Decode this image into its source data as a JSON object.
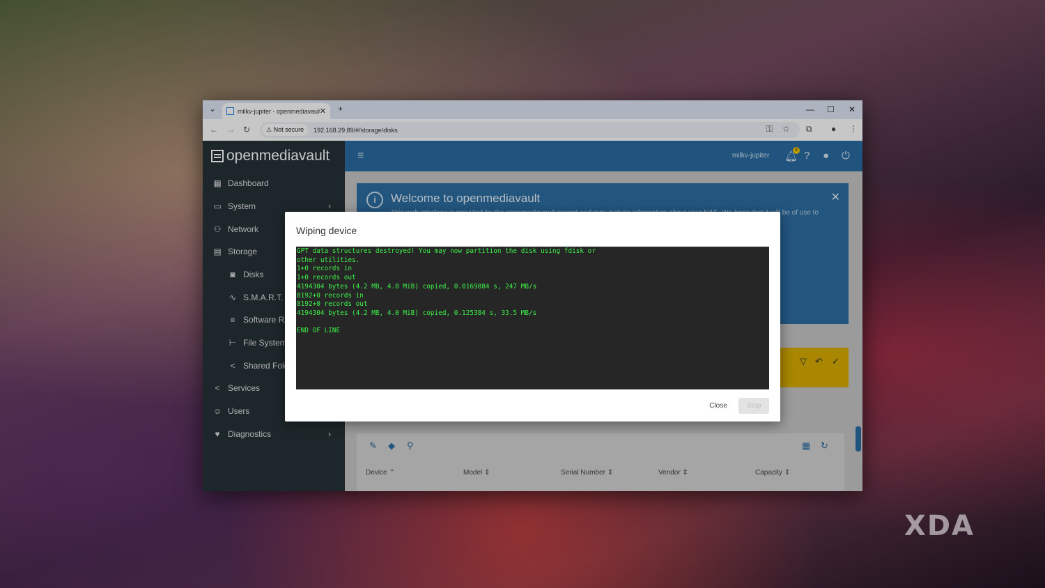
{
  "browser": {
    "tab_title": "milkv-jupiter - openmediavault",
    "tab_list_icon": "⌄",
    "new_tab": "+",
    "security_label": "Not secure",
    "url": "192.168.29.89/#/storage/disks"
  },
  "app": {
    "brand": "openmediavault",
    "hostname": "milkv-jupiter",
    "notification_count": "3"
  },
  "sidebar": {
    "items": [
      {
        "label": "Dashboard",
        "icon": "grid-icon"
      },
      {
        "label": "System",
        "icon": "laptop-icon"
      },
      {
        "label": "Network",
        "icon": "network-icon"
      },
      {
        "label": "Storage",
        "icon": "storage-icon"
      },
      {
        "label": "Disks",
        "icon": "disk-icon"
      },
      {
        "label": "S.M.A.R.T.",
        "icon": "pulse-icon"
      },
      {
        "label": "Software RA",
        "icon": "database-icon"
      },
      {
        "label": "File System",
        "icon": "tree-icon"
      },
      {
        "label": "Shared Fold",
        "icon": "share-icon"
      },
      {
        "label": "Services",
        "icon": "share-icon"
      },
      {
        "label": "Users",
        "icon": "users-icon"
      },
      {
        "label": "Diagnostics",
        "icon": "heartbeat-icon"
      }
    ]
  },
  "welcome": {
    "title": "Welcome to openmediavault",
    "body": "This web interface is provided by the openmediavault project and may include information about your NAS. We hope that it will be of use to"
  },
  "table": {
    "columns": [
      "Device",
      "Model",
      "Serial Number",
      "Vendor",
      "Capacity"
    ],
    "sort_indicators": [
      "⌃",
      "⇕",
      "⇕",
      "⇕",
      "⇕"
    ]
  },
  "dialog": {
    "title": "Wiping device",
    "output": "GPT data structures destroyed! You may now partition the disk using fdisk or\nother utilities.\n1+0 records in\n1+0 records out\n4194304 bytes (4.2 MB, 4.0 MiB) copied, 0.0169884 s, 247 MB/s\n8192+0 records in\n8192+0 records out\n4194304 bytes (4.2 MB, 4.0 MiB) copied, 0.125384 s, 33.5 MB/s\n\nEND OF LINE",
    "close_label": "Close",
    "stop_label": "Stop"
  },
  "watermark": "XDA"
}
